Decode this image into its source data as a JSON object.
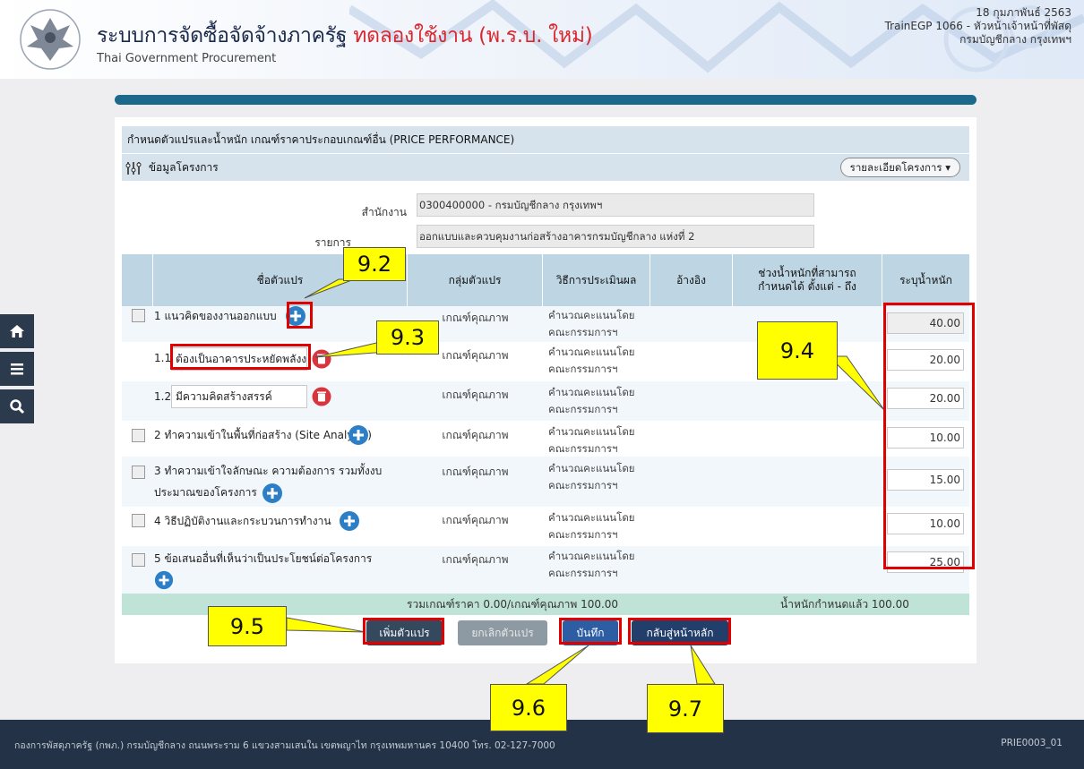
{
  "header": {
    "title": "ระบบการจัดซื้อจัดจ้างภาครัฐ",
    "trial": "ทดลองใช้งาน (พ.ร.บ. ใหม่)",
    "subtitle": "Thai Government Procurement",
    "date": "18 กุมภาพันธ์ 2563",
    "user": "TrainEGP 1066 - หัวหน้าเจ้าหน้าที่พัสดุ",
    "dept": "กรมบัญชีกลาง กรุงเทพฯ"
  },
  "sidebar": {
    "icons": [
      "home-icon",
      "menu-icon",
      "search-icon"
    ]
  },
  "section": {
    "title": "กำหนดตัวแปรและน้ำหนัก เกณฑ์ราคาประกอบเกณฑ์อื่น (PRICE PERFORMANCE)",
    "info_title": "ข้อมูลโครงการ",
    "detail_button": "รายละเอียดโครงการ ▾"
  },
  "form": {
    "agency_label": "สำนักงาน",
    "agency_value": "0300400000 - กรมบัญชีกลาง กรุงเทพฯ",
    "item_label": "รายการ",
    "item_value": "ออกแบบและควบคุมงานก่อสร้างอาคารกรมบัญชีกลาง แห่งที่ 2"
  },
  "table": {
    "headers": [
      "ชื่อตัวแปร",
      "กลุ่มตัวแปร",
      "วิธีการประเมินผล",
      "อ้างอิง",
      "ช่วงน้ำหนักที่สามารถ กำหนดได้ ตั้งแต่ - ถึง",
      "ระบุน้ำหนัก"
    ],
    "method": [
      "คำนวณคะแนนโดย",
      "คณะกรรมการฯ"
    ],
    "rows": [
      {
        "name": "1 แนวคิดของงานออกแบบ",
        "group": "เกณฑ์คุณภาพ",
        "weight": "40.00"
      },
      {
        "name": "1.1",
        "input": "ต้องเป็นอาคารประหยัดพลังงาน",
        "group": "เกณฑ์คุณภาพ",
        "weight": "20.00"
      },
      {
        "name": "1.2",
        "input": "มีความคิดสร้างสรรค์",
        "group": "เกณฑ์คุณภาพ",
        "weight": "20.00"
      },
      {
        "name": "2 ทำความเข้าในพื้นที่ก่อสร้าง (Site Analysis)",
        "group": "เกณฑ์คุณภาพ",
        "weight": "10.00"
      },
      {
        "name": "3 ทำความเข้าใจลักษณะ ความต้องการ รวมทั้งงบ",
        "name2": "ประมาณของโครงการ",
        "group": "เกณฑ์คุณภาพ",
        "weight": "15.00"
      },
      {
        "name": "4 วิธีปฏิบัติงานและกระบวนการทำงาน",
        "group": "เกณฑ์คุณภาพ",
        "weight": "10.00"
      },
      {
        "name": "5 ข้อเสนออื่นที่เห็นว่าเป็นประโยชน์ต่อโครงการ",
        "group": "เกณฑ์คุณภาพ",
        "weight": "25.00"
      }
    ],
    "totals_left": "รวมเกณฑ์ราคา 0.00/เกณฑ์คุณภาพ 100.00",
    "totals_right": "น้ำหนักกำหนดแล้ว 100.00"
  },
  "buttons": {
    "add": "เพิ่มตัวแปร",
    "cancel": "ยกเลิกตัวแปร",
    "save": "บันทึก",
    "back": "กลับสู่หน้าหลัก"
  },
  "callouts": {
    "c92": "9.2",
    "c93": "9.3",
    "c94": "9.4",
    "c95": "9.5",
    "c96": "9.6",
    "c97": "9.7"
  },
  "footer": {
    "address": "กองการพัสดุภาครัฐ (กพภ.) กรมบัญชีกลาง ถนนพระราม 6 แขวงสามเสนใน เขตพญาไท กรุงเทพมหานคร 10400 โทร. 02-127-7000",
    "code": "PRIE0003_01"
  },
  "colors": {
    "accent": "#1b6a8c",
    "header_row": "#bed5e3",
    "totals_row": "#bfe4d7",
    "annotation_red": "#e00000",
    "callout_yellow": "#ffff00",
    "plus_blue": "#2c7fc6",
    "trash_red": "#d9343b"
  }
}
